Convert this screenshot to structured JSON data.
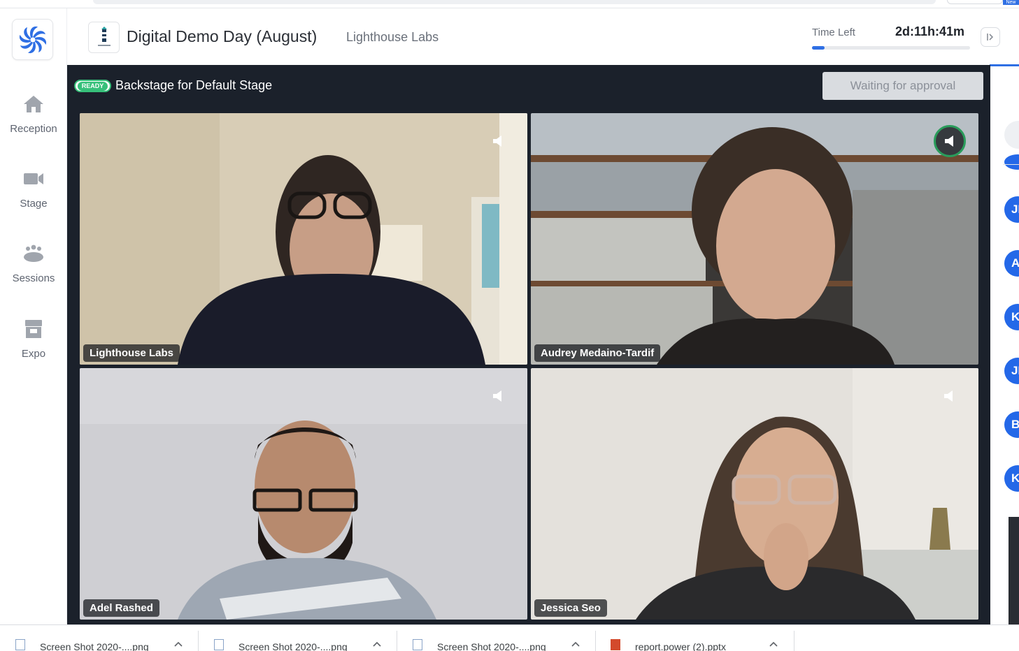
{
  "sidebar": {
    "logo_icon": "hopin-spiral-logo-icon",
    "items": [
      {
        "label": "Reception",
        "icon": "home-icon"
      },
      {
        "label": "Stage",
        "icon": "video-camera-icon"
      },
      {
        "label": "Sessions",
        "icon": "people-group-icon"
      },
      {
        "label": "Expo",
        "icon": "storefront-icon"
      }
    ]
  },
  "header": {
    "event_title": "Digital Demo Day (August)",
    "organizer": "Lighthouse Labs",
    "time_left_label": "Time Left",
    "time_left_value": "2d:11h:41m",
    "time_progress_fraction": 0.08
  },
  "stage": {
    "status_badge": "READY",
    "title": "Backstage for Default Stage",
    "approval_button": "Waiting for approval",
    "participants": [
      {
        "name": "Lighthouse Labs",
        "speaking": false
      },
      {
        "name": "Audrey Medaino-Tardif",
        "speaking": true
      },
      {
        "name": "Adel Rashed",
        "speaking": false
      },
      {
        "name": "Jessica Seo",
        "speaking": false
      }
    ]
  },
  "attendees": {
    "avatars": [
      "JI",
      "AI",
      "K",
      "JI",
      "B(",
      "KI"
    ]
  },
  "top_strip": {
    "new_tag": "New"
  },
  "downloads": [
    {
      "name": "Screen Shot 2020-....png",
      "type": "png"
    },
    {
      "name": "Screen Shot 2020-....png",
      "type": "png"
    },
    {
      "name": "Screen Shot 2020-....png",
      "type": "png"
    },
    {
      "name": "report.power (2).pptx",
      "type": "pptx"
    }
  ],
  "colors": {
    "accent": "#2f6fe4",
    "stage_bg": "#1b212b",
    "ready_green": "#36c07a",
    "speaking_ring": "#2a9c5b"
  }
}
